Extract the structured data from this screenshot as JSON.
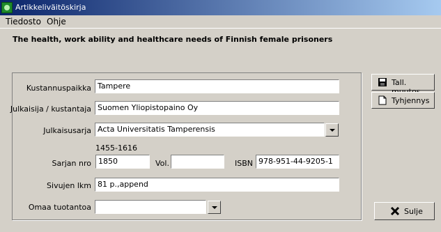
{
  "window": {
    "title": "Artikkeliväitöskirja"
  },
  "menu": {
    "file": "Tiedosto",
    "help": "Ohje"
  },
  "header": {
    "title": "The health, work ability and healthcare needs of Finnish female prisoners"
  },
  "form": {
    "place_label": "Kustannuspaikka",
    "place_value": "Tampere",
    "publisher_label": "Julkaisija / kustantaja",
    "publisher_value": "Suomen Yliopistopaino Oy",
    "series_label": "Julkaisusarja",
    "series_value": "Acta Universitatis Tamperensis",
    "issn_value": "1455-1616",
    "series_no_label": "Sarjan nro",
    "series_no_value": "1850",
    "vol_label": "Vol.",
    "vol_value": "",
    "isbn_label": "ISBN",
    "isbn_value": "978-951-44-9205-1",
    "pages_label": "Sivujen lkm",
    "pages_value": "81 p.,append",
    "own_label": "Omaa tuotantoa",
    "own_value": ""
  },
  "buttons": {
    "save": "Tall. muutos",
    "clear": "Tyhjennys",
    "close": "Sulje"
  }
}
